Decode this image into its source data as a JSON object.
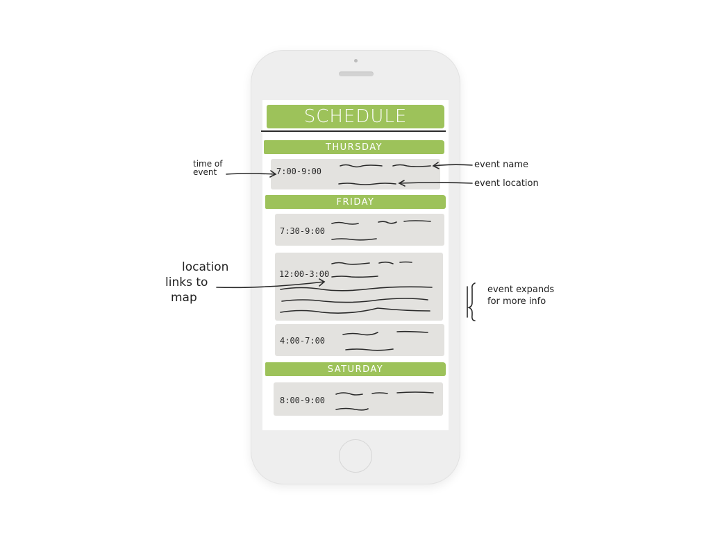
{
  "header": {
    "title": "SCHEDULE"
  },
  "days": [
    {
      "label": "THURSDAY",
      "events": [
        {
          "time": "7:00-9:00"
        }
      ]
    },
    {
      "label": "FRIDAY",
      "events": [
        {
          "time": "7:30-9:00"
        },
        {
          "time": "12:00-3:00"
        },
        {
          "time": "4:00-7:00"
        }
      ]
    },
    {
      "label": "SATURDAY",
      "events": [
        {
          "time": "8:00-9:00"
        }
      ]
    }
  ],
  "annotations": {
    "time_of_event_line1": "time of",
    "time_of_event_line2": "event",
    "event_name": "event name",
    "event_location": "event location",
    "location_links_line1": "location",
    "location_links_line2": "links to",
    "location_links_line3": "map",
    "event_expands_line1": "event expands",
    "event_expands_line2": "for more info"
  },
  "colors": {
    "accent": "#9dc25a",
    "card": "#e3e2df",
    "phone": "#eeeeee",
    "ink": "#222222"
  }
}
